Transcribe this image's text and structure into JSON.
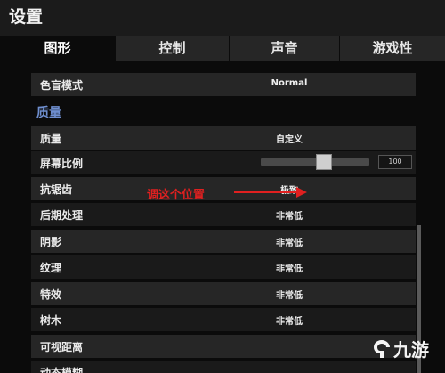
{
  "window": {
    "title": "设置"
  },
  "tabs": [
    {
      "label": "图形",
      "active": true
    },
    {
      "label": "控制",
      "active": false
    },
    {
      "label": "声音",
      "active": false
    },
    {
      "label": "游戏性",
      "active": false
    }
  ],
  "rows_top": [
    {
      "label": "色盲模式",
      "value": "Normal"
    }
  ],
  "section": {
    "title": "质量"
  },
  "rows": [
    {
      "label": "质量",
      "value": "自定义"
    },
    {
      "label": "屏幕比例",
      "value": "",
      "slider": true
    },
    {
      "label": "抗锯齿",
      "value": "极致"
    },
    {
      "label": "后期处理",
      "value": "非常低"
    },
    {
      "label": "阴影",
      "value": "非常低"
    },
    {
      "label": "纹理",
      "value": "非常低"
    },
    {
      "label": "特效",
      "value": "非常低"
    },
    {
      "label": "树木",
      "value": "非常低"
    },
    {
      "label": "可视距离",
      "value": ""
    },
    {
      "label": "动态模糊",
      "value": ""
    }
  ],
  "slider": {
    "value_text": "100",
    "fraction": 0.6
  },
  "annotation": {
    "text": "调这个位置",
    "color": "#e02020"
  },
  "watermark": {
    "text": "九游"
  },
  "colors": {
    "accent": "#6f8fd0",
    "row_dark": "#262626",
    "row_light": "#1a1a1a"
  }
}
